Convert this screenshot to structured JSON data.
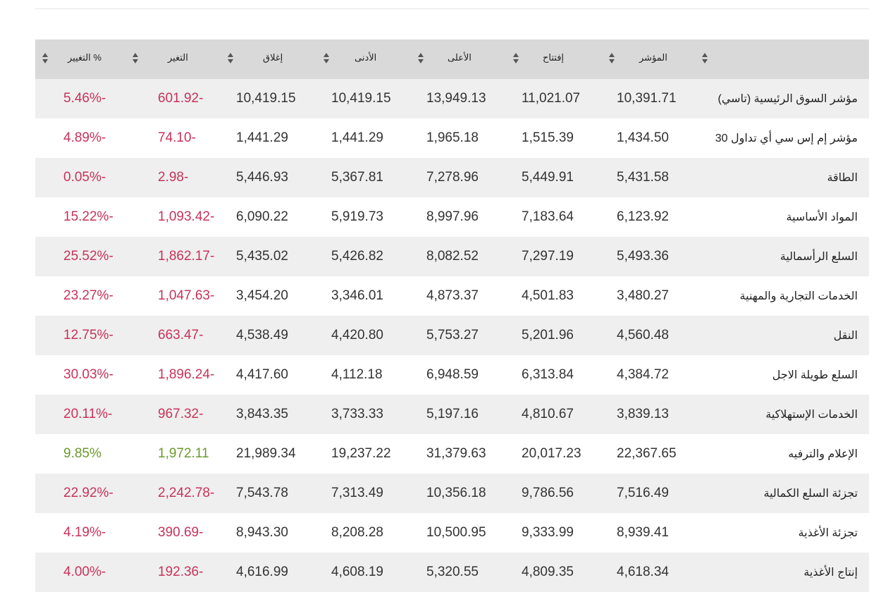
{
  "table": {
    "headers": {
      "index": "المؤشر",
      "open": "إفتتاح",
      "high": "الأعلى",
      "low": "الأدنى",
      "close": "إغلاق",
      "change": "التغير",
      "pct": "% التغيير"
    },
    "rows": [
      {
        "name": "مؤشر السوق الرئيسية (تاسي)",
        "index": "10,391.71",
        "open": "11,021.07",
        "high": "13,949.13",
        "low": "10,419.15",
        "close": "10,419.15",
        "change": "601.92-",
        "pct": "5.46%-",
        "dir": "neg"
      },
      {
        "name": "مؤشر إم إس سي أي تداول 30",
        "index": "1,434.50",
        "open": "1,515.39",
        "high": "1,965.18",
        "low": "1,441.29",
        "close": "1,441.29",
        "change": "74.10-",
        "pct": "4.89%-",
        "dir": "neg"
      },
      {
        "name": "الطاقة",
        "index": "5,431.58",
        "open": "5,449.91",
        "high": "7,278.96",
        "low": "5,367.81",
        "close": "5,446.93",
        "change": "2.98-",
        "pct": "0.05%-",
        "dir": "neg"
      },
      {
        "name": "المواد الأساسية",
        "index": "6,123.92",
        "open": "7,183.64",
        "high": "8,997.96",
        "low": "5,919.73",
        "close": "6,090.22",
        "change": "1,093.42-",
        "pct": "15.22%-",
        "dir": "neg"
      },
      {
        "name": "السلع الرأسمالية",
        "index": "5,493.36",
        "open": "7,297.19",
        "high": "8,082.52",
        "low": "5,426.82",
        "close": "5,435.02",
        "change": "1,862.17-",
        "pct": "25.52%-",
        "dir": "neg"
      },
      {
        "name": "الخدمات التجارية والمهنية",
        "index": "3,480.27",
        "open": "4,501.83",
        "high": "4,873.37",
        "low": "3,346.01",
        "close": "3,454.20",
        "change": "1,047.63-",
        "pct": "23.27%-",
        "dir": "neg"
      },
      {
        "name": "النقل",
        "index": "4,560.48",
        "open": "5,201.96",
        "high": "5,753.27",
        "low": "4,420.80",
        "close": "4,538.49",
        "change": "663.47-",
        "pct": "12.75%-",
        "dir": "neg"
      },
      {
        "name": "السلع طويلة الاجل",
        "index": "4,384.72",
        "open": "6,313.84",
        "high": "6,948.59",
        "low": "4,112.18",
        "close": "4,417.60",
        "change": "1,896.24-",
        "pct": "30.03%-",
        "dir": "neg"
      },
      {
        "name": "الخدمات الإستهلاكية",
        "index": "3,839.13",
        "open": "4,810.67",
        "high": "5,197.16",
        "low": "3,733.33",
        "close": "3,843.35",
        "change": "967.32-",
        "pct": "20.11%-",
        "dir": "neg"
      },
      {
        "name": "الإعلام والترفيه",
        "index": "22,367.65",
        "open": "20,017.23",
        "high": "31,379.63",
        "low": "19,237.22",
        "close": "21,989.34",
        "change": "1,972.11",
        "pct": "9.85%",
        "dir": "pos"
      },
      {
        "name": "تجزئة السلع الكمالية",
        "index": "7,516.49",
        "open": "9,786.56",
        "high": "10,356.18",
        "low": "7,313.49",
        "close": "7,543.78",
        "change": "2,242.78-",
        "pct": "22.92%-",
        "dir": "neg"
      },
      {
        "name": "تجزئة الأغذية",
        "index": "8,939.41",
        "open": "9,333.99",
        "high": "10,500.95",
        "low": "8,208.28",
        "close": "8,943.30",
        "change": "390.69-",
        "pct": "4.19%-",
        "dir": "neg"
      },
      {
        "name": "إنتاج الأغذية",
        "index": "4,618.34",
        "open": "4,809.35",
        "high": "5,320.55",
        "low": "4,608.19",
        "close": "4,616.99",
        "change": "192.36-",
        "pct": "4.00%-",
        "dir": "neg"
      }
    ]
  }
}
